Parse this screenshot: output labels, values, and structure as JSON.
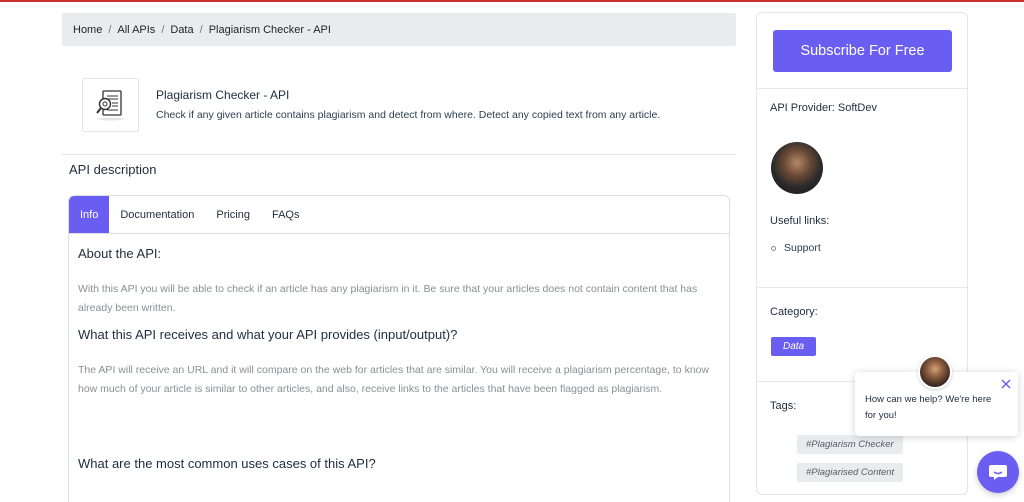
{
  "colors": {
    "accent": "#6a5ef2",
    "topline": "#c9302c",
    "breadcrumb_bg": "#e9ecef"
  },
  "breadcrumb": {
    "items": [
      "Home",
      "All APIs",
      "Data",
      "Plagiarism Checker - API"
    ],
    "separator": "/"
  },
  "api": {
    "icon": "document-magnifier-icon",
    "title": "Plagiarism Checker - API",
    "subtitle": "Check if any given article contains plagiarism and detect from where. Detect any copied text from any article."
  },
  "description": {
    "heading": "API description"
  },
  "tabs": {
    "items": [
      "Info",
      "Documentation",
      "Pricing",
      "FAQs"
    ],
    "active": "Info"
  },
  "info": {
    "about_heading": "About the API:",
    "about_text": " With this API you will be able to check if an article has any plagiarism in it. Be sure that your articles does not contain content that has already been written.",
    "receives_heading": "What this API receives and what your API provides (input/output)?",
    "receives_text": "The API will receive an URL and it will compare on the web for articles that are similar. You will receive a plagiarism percentage, to know how much of your article is similar to other articles, and also, receive links to the articles that have been flagged as plagiarism.",
    "uses_heading": "What are the most common uses cases of this API?"
  },
  "sidebar": {
    "subscribe_label": "Subscribe For Free",
    "provider_label": "API Provider: SoftDev",
    "useful_links_label": "Useful links:",
    "links": [
      "Support"
    ],
    "category_label": "Category:",
    "category": "Data",
    "tags_label": "Tags:",
    "tags": [
      "#Plagiarism Checker",
      "#Plagiarised Content"
    ]
  },
  "chat": {
    "message": "How can we help? We're here for you!",
    "close_icon": "close-icon",
    "launcher_icon": "chat-bubble-icon"
  }
}
